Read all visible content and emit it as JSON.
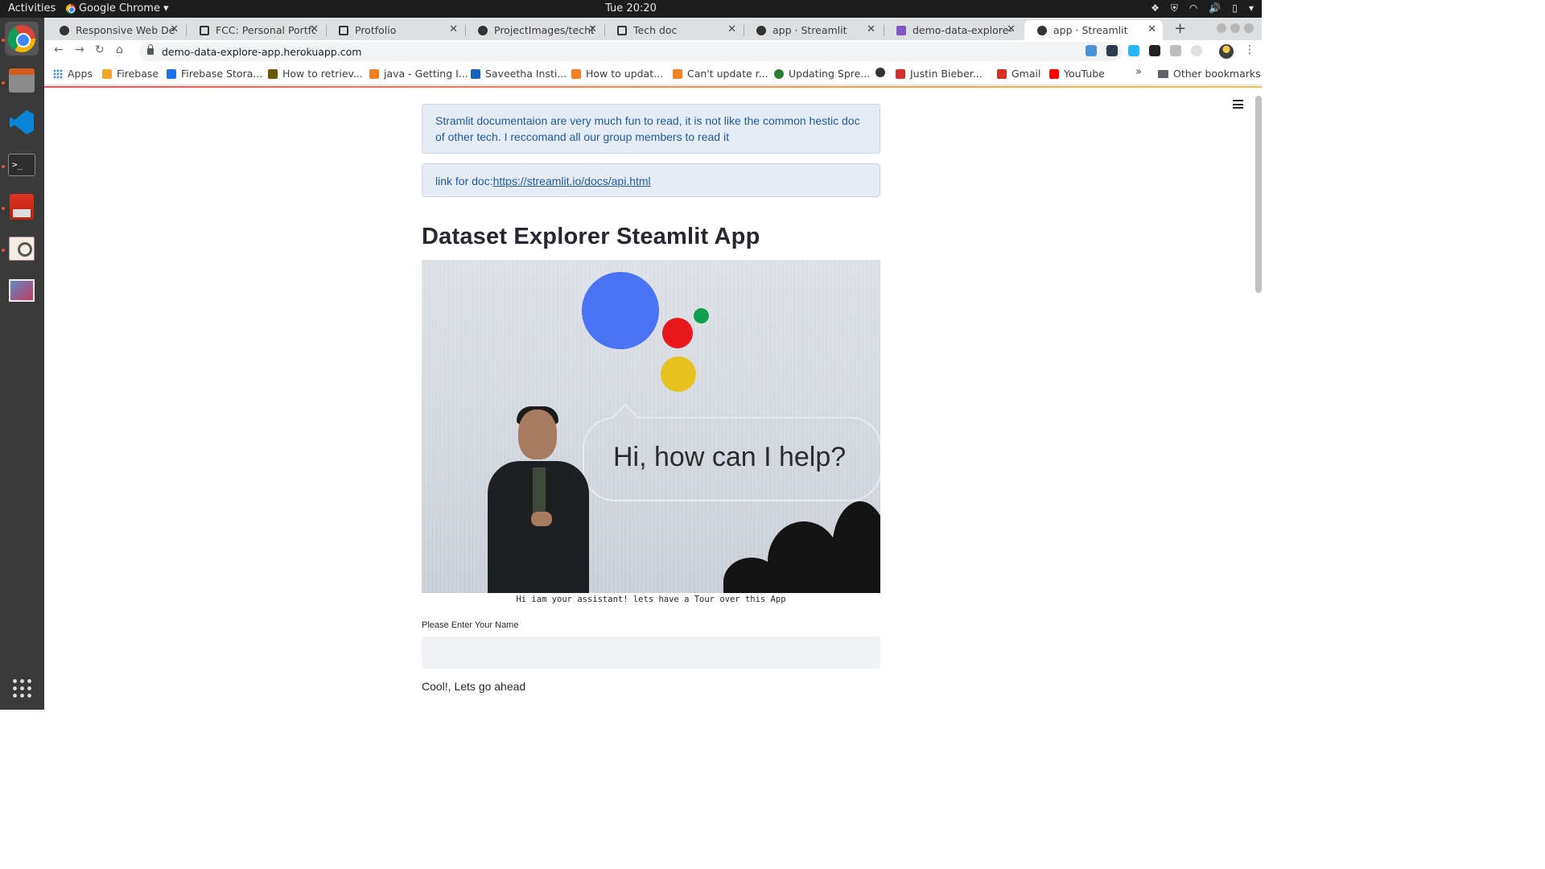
{
  "topbar": {
    "activities": "Activities",
    "app_name": "Google Chrome",
    "clock": "Tue 20:20",
    "tray_icons": [
      "dropbox-icon",
      "shield-icon",
      "wifi-icon",
      "volume-icon",
      "battery-icon",
      "system-menu-icon"
    ]
  },
  "dock": {
    "apps": [
      "chrome-icon",
      "files-icon",
      "vscode-icon",
      "terminal-icon",
      "software-install-icon",
      "image-viewer-icon",
      "photos-icon",
      "show-applications-icon"
    ]
  },
  "tabs": [
    {
      "label": "Responsive Web Design",
      "active": false
    },
    {
      "label": "FCC: Personal Portfolio",
      "active": false
    },
    {
      "label": "Protfolio",
      "active": false
    },
    {
      "label": "ProjectImages/techDoc",
      "active": false
    },
    {
      "label": "Tech doc",
      "active": false
    },
    {
      "label": "app · Streamlit",
      "active": false
    },
    {
      "label": "demo-data-explore-app",
      "active": false
    },
    {
      "label": "app · Streamlit",
      "active": true
    }
  ],
  "toolbar": {
    "url": "demo-data-explore-app.herokuapp.com"
  },
  "bookmarks": {
    "items": [
      {
        "label": "Apps",
        "color": "#4285f4"
      },
      {
        "label": "Firebase",
        "color": "#f5a623"
      },
      {
        "label": "Firebase Stora...",
        "color": "#1a73e8"
      },
      {
        "label": "How to retriev...",
        "color": "#6b5b00"
      },
      {
        "label": "java - Getting I...",
        "color": "#f48024"
      },
      {
        "label": "Saveetha Insti...",
        "color": "#1565c0"
      },
      {
        "label": "How to updat...",
        "color": "#f48024"
      },
      {
        "label": "Can't update r...",
        "color": "#f48024"
      },
      {
        "label": "Updating Spre...",
        "color": "#2e7d32"
      },
      {
        "label": "",
        "color": "#333333"
      },
      {
        "label": "Justin Bieber...",
        "color": "#d32f2f"
      },
      {
        "label": "Gmail",
        "color": "#d93025"
      },
      {
        "label": "YouTube",
        "color": "#ff0000"
      }
    ],
    "more": "»",
    "other": "Other bookmarks"
  },
  "page": {
    "info1": "Stramlit documentaion are very much fun to read, it is not like the common hestic doc of other tech. I reccomand all our group members to read it",
    "info2_prefix": "link for doc:",
    "info2_link": "https://streamlit.io/docs/api.html",
    "title": "Dataset Explorer Steamlit App",
    "hero_text": "Hi, how can I help?",
    "caption": "Hi iam your assistant! lets have a Tour over this App",
    "name_label": "Please Enter Your Name",
    "name_value": "",
    "cool_text": "Cool!, Lets go ahead"
  },
  "colors": {
    "info_bg": "#e6ecf6",
    "info_text": "#1f5b99",
    "assistant_blue": "#4a72f5",
    "assistant_red": "#e8171c",
    "assistant_green": "#0fa04f",
    "assistant_yellow": "#e6c31c"
  }
}
